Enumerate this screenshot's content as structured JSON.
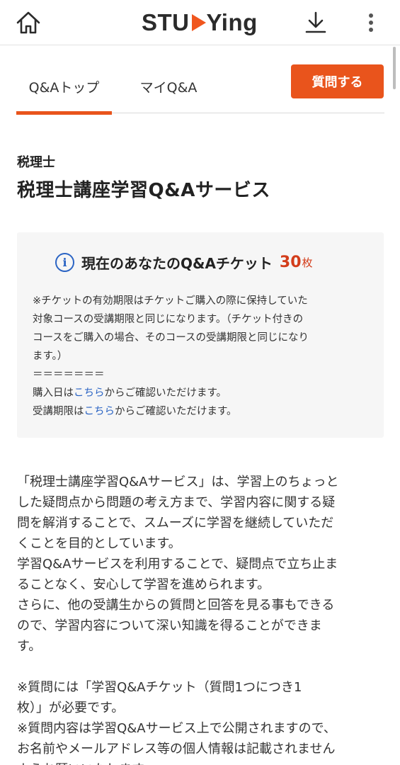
{
  "header": {
    "logo_before": "STU",
    "logo_after": "Ying"
  },
  "tabs": [
    {
      "label": "Q&Aトップ",
      "active": true
    },
    {
      "label": "マイQ&A",
      "active": false
    }
  ],
  "ask_button": "質問する",
  "category": "税理士",
  "page_title": "税理士講座学習Q&Aサービス",
  "ticket": {
    "heading": "現在のあなたのQ&Aチケット",
    "count": "30",
    "unit": "枚",
    "note_lines": [
      "※チケットの有効期限はチケットご購入の際に保持していた",
      "対象コースの受講期限と同じになります。（チケット付きの",
      "コースをご購入の場合、そのコースの受講期限と同じになり",
      "ます。）",
      "＝＝＝＝＝＝＝"
    ],
    "purchase_prefix": "購入日は",
    "purchase_link": "こちら",
    "purchase_suffix": "からご確認いただけます。",
    "period_prefix": "受講期限は",
    "period_link": "こちら",
    "period_suffix": "からご確認いただけます。"
  },
  "description_lines": [
    "「税理士講座学習Q&Aサービス」は、学習上のちょっと",
    "した疑問点から問題の考え方まで、学習内容に関する疑",
    "問を解消することで、スムーズに学習を継続していただ",
    "くことを目的としています。",
    "学習Q&Aサービスを利用することで、疑問点で立ち止ま",
    "ることなく、安心して学習を進められます。",
    "さらに、他の受講生からの質問と回答を見る事もできる",
    "ので、学習内容について深い知識を得ることができま",
    "す。"
  ],
  "notice_lines": [
    "※質問には「学習Q&Aチケット（質問1つにつき1",
    "枚）」が必要です。",
    "※質問内容は学習Q&Aサービス上で公開されますので、",
    "お名前やメールアドレス等の個人情報は記載されません",
    "ようお願いいたします。"
  ],
  "colors": {
    "accent": "#e9541c",
    "link": "#2b64c4",
    "ticket_count": "#d33d1b"
  },
  "icons": {
    "home": "home-icon",
    "download": "download-icon",
    "more": "more-vertical-icon",
    "info": "info-icon",
    "logo_play": "play-triangle-icon"
  }
}
